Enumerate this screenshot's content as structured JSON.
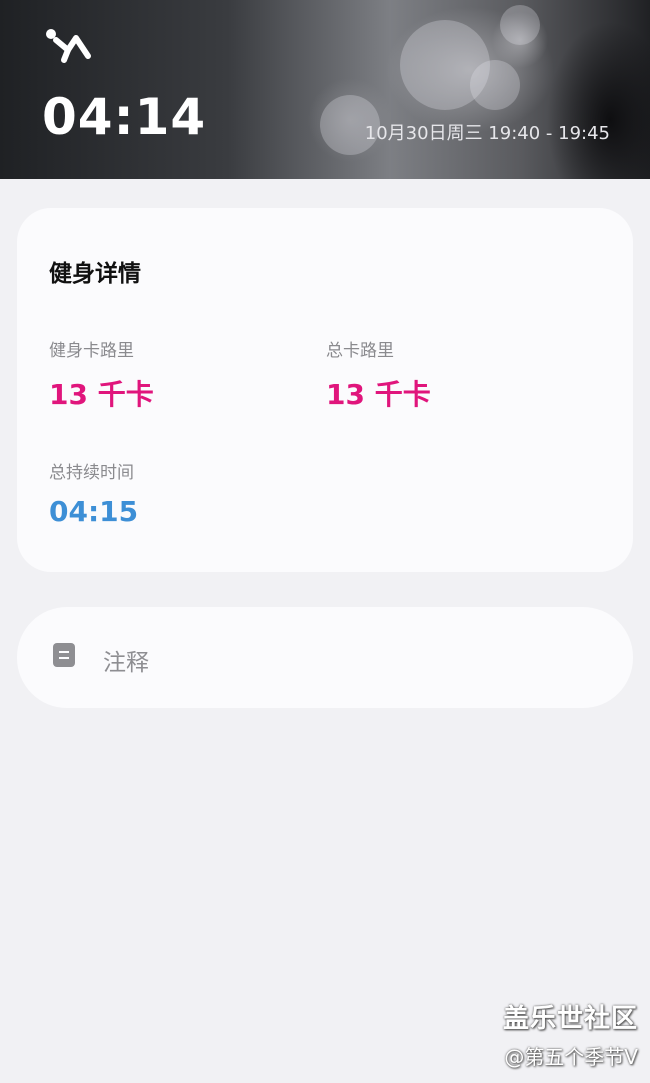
{
  "header": {
    "icon": "running-person-icon",
    "duration": "04:14",
    "datetime": "10月30日周三 19:40 - 19:45"
  },
  "details": {
    "title": "健身详情",
    "stats": [
      {
        "label": "健身卡路里",
        "value": "13 千卡",
        "color": "#e0157c"
      },
      {
        "label": "总卡路里",
        "value": "13 千卡",
        "color": "#e0157c"
      },
      {
        "label": "总持续时间",
        "value": "04:15",
        "color": "#3d8fd6"
      }
    ]
  },
  "note": {
    "icon": "note-icon",
    "label": "注释"
  },
  "watermark": {
    "main": "盖乐世社区",
    "sub": "@第五个季节V"
  }
}
